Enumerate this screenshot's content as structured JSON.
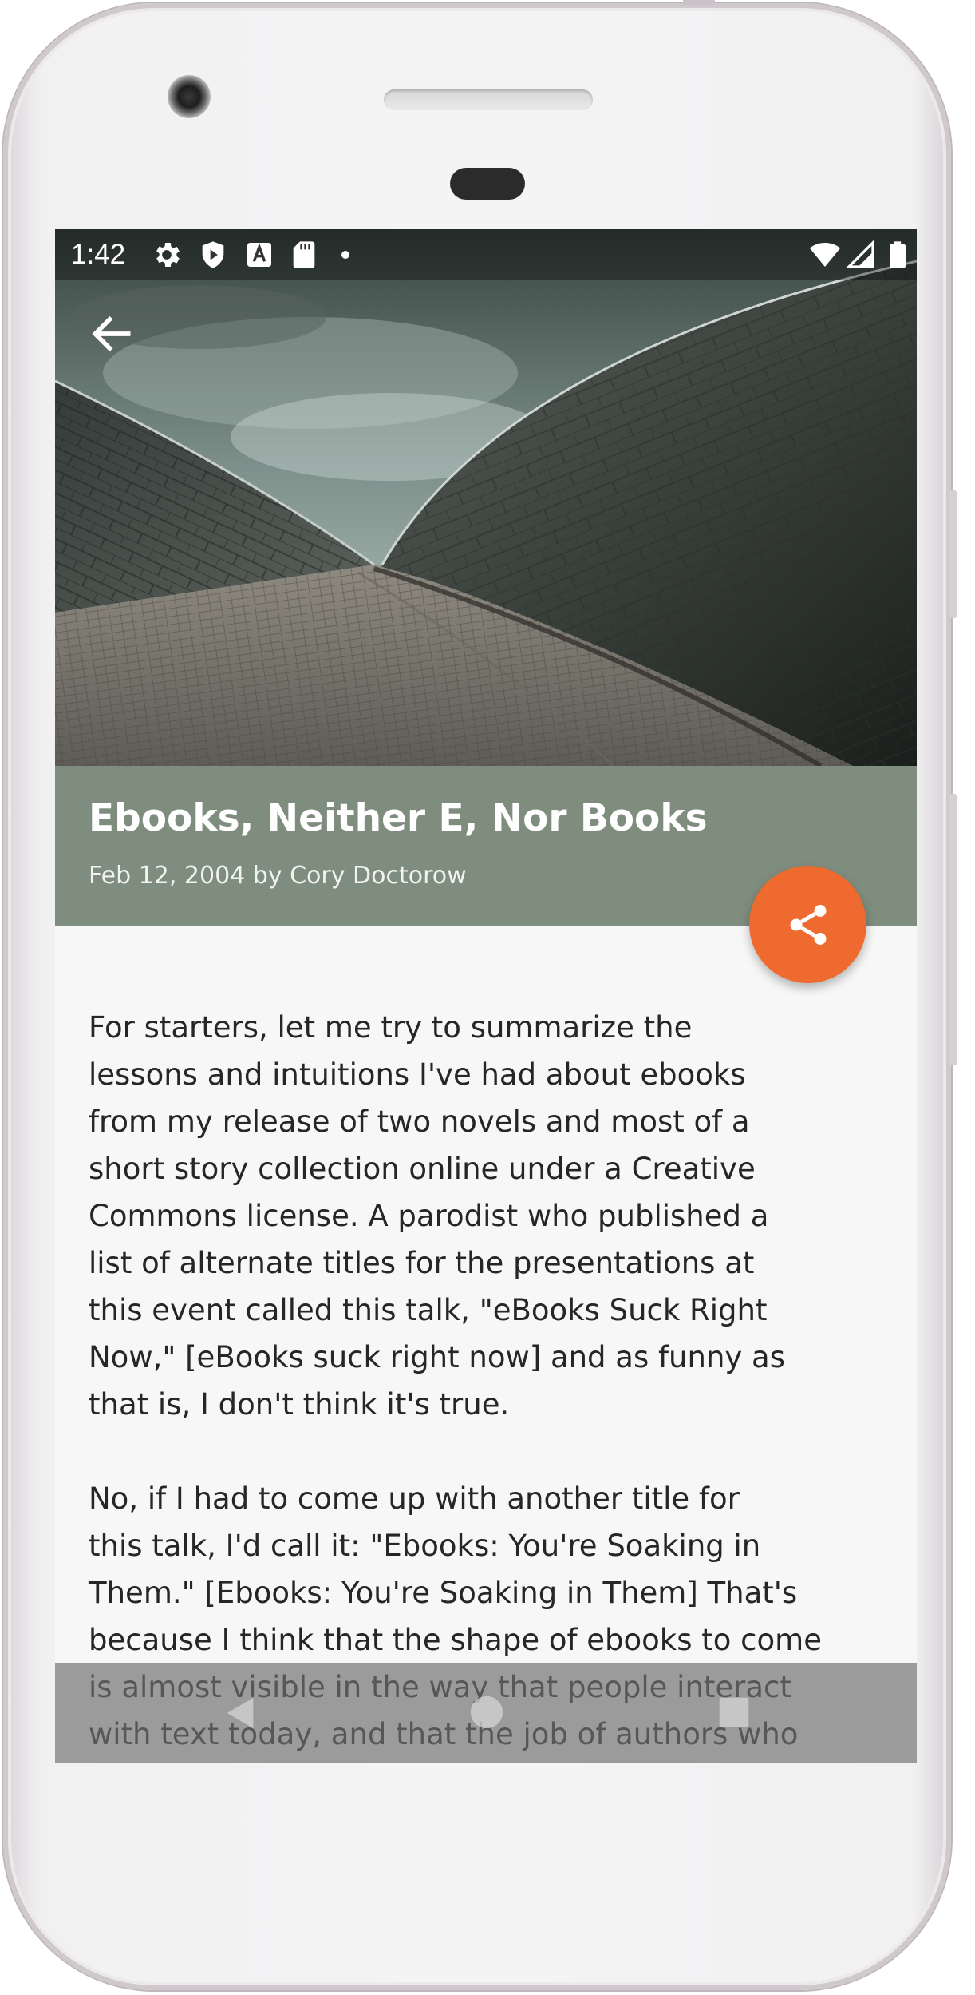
{
  "status_bar": {
    "time": "1:42",
    "left_icons": [
      "settings-icon",
      "shield-play-icon",
      "font-a-icon",
      "sd-card-icon",
      "dot-icon"
    ],
    "right_icons": [
      "wifi-icon",
      "signal-icon",
      "battery-icon"
    ]
  },
  "header": {
    "back_icon": "arrow-back-icon"
  },
  "article": {
    "title": "Ebooks, Neither E, Nor Books",
    "meta": "Feb 12, 2004 by Cory Doctorow",
    "paragraphs": [
      "For starters, let me try to summarize the\nlessons and intuitions I've had about ebooks\nfrom my release of two novels and most of a\nshort story collection online under a Creative\nCommons license. A parodist who published a\nlist of alternate titles for the presentations at\nthis event called this talk, \"eBooks Suck Right\nNow,\" [eBooks suck right now] and as funny as\nthat is, I don't think it's true.",
      "No, if I had to come up with another title for\nthis talk, I'd call it: \"Ebooks: You're Soaking in\nThem.\" [Ebooks: You're Soaking in Them] That's\nbecause I think that the shape of ebooks to come\nis almost visible in the way that people interact\nwith text today, and that the job of authors who"
    ]
  },
  "fab": {
    "icon": "share-icon",
    "color": "#ee6a2f"
  },
  "colors": {
    "title_block": "#7f8d7f",
    "accent": "#ee6a2f",
    "background": "#f7f7f7"
  },
  "nav_bar": {
    "buttons": [
      "back-triangle-icon",
      "home-circle-icon",
      "recents-square-icon"
    ]
  }
}
